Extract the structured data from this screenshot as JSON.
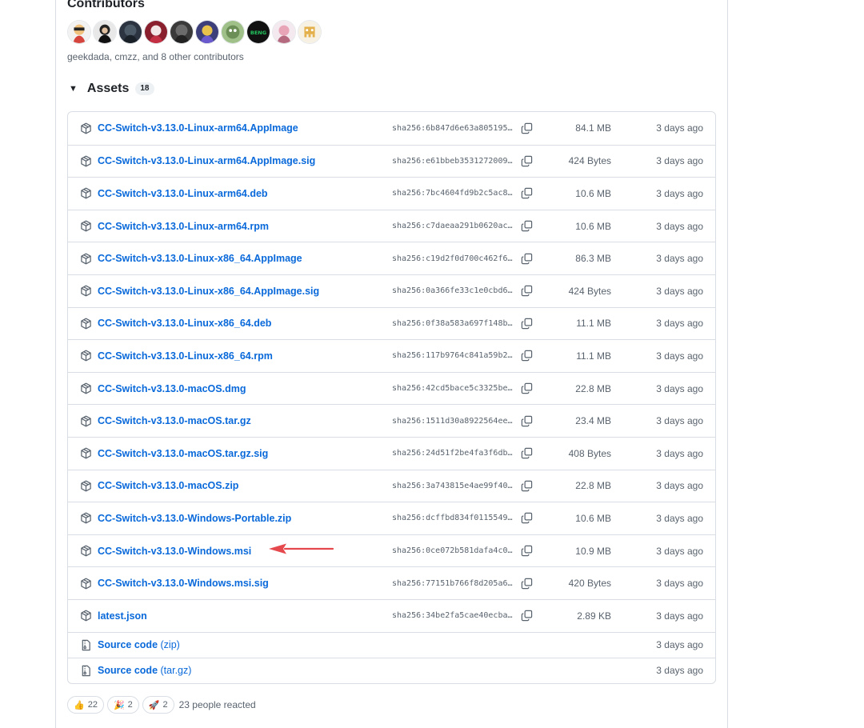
{
  "contributors": {
    "title": "Contributors",
    "names_text": "geekdada, cmzz, and 8 other contributors",
    "avatar_count": 10
  },
  "assets": {
    "title": "Assets",
    "count": "18",
    "items": [
      {
        "name": "CC-Switch-v3.13.0-Linux-arm64.AppImage",
        "sha": "sha256:6b847d6e63a805195…",
        "size": "84.1 MB",
        "date": "3 days ago"
      },
      {
        "name": "CC-Switch-v3.13.0-Linux-arm64.AppImage.sig",
        "sha": "sha256:e61bbeb3531272009…",
        "size": "424 Bytes",
        "date": "3 days ago"
      },
      {
        "name": "CC-Switch-v3.13.0-Linux-arm64.deb",
        "sha": "sha256:7bc4604fd9b2c5ac8…",
        "size": "10.6 MB",
        "date": "3 days ago"
      },
      {
        "name": "CC-Switch-v3.13.0-Linux-arm64.rpm",
        "sha": "sha256:c7daeaa291b0620ac…",
        "size": "10.6 MB",
        "date": "3 days ago"
      },
      {
        "name": "CC-Switch-v3.13.0-Linux-x86_64.AppImage",
        "sha": "sha256:c19d2f0d700c462f6…",
        "size": "86.3 MB",
        "date": "3 days ago"
      },
      {
        "name": "CC-Switch-v3.13.0-Linux-x86_64.AppImage.sig",
        "sha": "sha256:0a366fe33c1e0cbd6…",
        "size": "424 Bytes",
        "date": "3 days ago"
      },
      {
        "name": "CC-Switch-v3.13.0-Linux-x86_64.deb",
        "sha": "sha256:0f38a583a697f148b…",
        "size": "11.1 MB",
        "date": "3 days ago"
      },
      {
        "name": "CC-Switch-v3.13.0-Linux-x86_64.rpm",
        "sha": "sha256:117b9764c841a59b2…",
        "size": "11.1 MB",
        "date": "3 days ago"
      },
      {
        "name": "CC-Switch-v3.13.0-macOS.dmg",
        "sha": "sha256:42cd5bace5c3325be…",
        "size": "22.8 MB",
        "date": "3 days ago"
      },
      {
        "name": "CC-Switch-v3.13.0-macOS.tar.gz",
        "sha": "sha256:1511d30a8922564ee…",
        "size": "23.4 MB",
        "date": "3 days ago"
      },
      {
        "name": "CC-Switch-v3.13.0-macOS.tar.gz.sig",
        "sha": "sha256:24d51f2be4fa3f6db…",
        "size": "408 Bytes",
        "date": "3 days ago"
      },
      {
        "name": "CC-Switch-v3.13.0-macOS.zip",
        "sha": "sha256:3a743815e4ae99f40…",
        "size": "22.8 MB",
        "date": "3 days ago"
      },
      {
        "name": "CC-Switch-v3.13.0-Windows-Portable.zip",
        "sha": "sha256:dcffbd834f0115549…",
        "size": "10.6 MB",
        "date": "3 days ago"
      },
      {
        "name": "CC-Switch-v3.13.0-Windows.msi",
        "sha": "sha256:0ce072b581dafa4c0…",
        "size": "10.9 MB",
        "date": "3 days ago"
      },
      {
        "name": "CC-Switch-v3.13.0-Windows.msi.sig",
        "sha": "sha256:77151b766f8d205a6…",
        "size": "420 Bytes",
        "date": "3 days ago"
      },
      {
        "name": "latest.json",
        "sha": "sha256:34be2fa5cae40ecba…",
        "size": "2.89 KB",
        "date": "3 days ago"
      }
    ],
    "source": [
      {
        "label": "Source code",
        "suffix": "(zip)",
        "date": "3 days ago"
      },
      {
        "label": "Source code",
        "suffix": "(tar.gz)",
        "date": "3 days ago"
      }
    ]
  },
  "annotation": {
    "arrow_color": "#e5484d"
  },
  "reactions": {
    "items": [
      {
        "emoji": "👍",
        "count": "22"
      },
      {
        "emoji": "🎉",
        "count": "2"
      },
      {
        "emoji": "🚀",
        "count": "2"
      }
    ],
    "summary": "23 people reacted"
  },
  "colors": {
    "link": "#0969da",
    "muted": "#59636e",
    "border": "#d8dee4"
  }
}
